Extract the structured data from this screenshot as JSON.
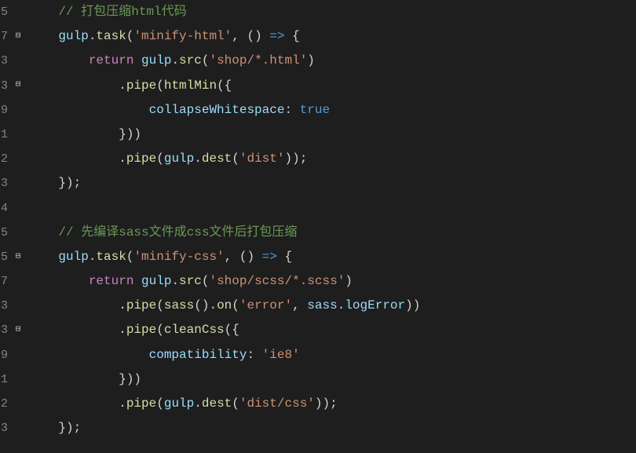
{
  "lineNumbers": [
    "5",
    "7",
    "3",
    "3",
    "9",
    "1",
    "2",
    "3",
    "4",
    "5",
    "5",
    "7",
    "3",
    "3",
    "9",
    "1",
    "2",
    "3"
  ],
  "folds": [
    "",
    "⊟",
    "",
    "⊟",
    "",
    "",
    "",
    "",
    "",
    "",
    "⊟",
    "",
    "",
    "⊟",
    "",
    "",
    "",
    ""
  ],
  "code": {
    "l1_comment": "// 打包压缩html代码",
    "l2_gulp": "gulp",
    "l2_task": "task",
    "l2_str": "'minify-html'",
    "l3_return": "return",
    "l3_gulp": "gulp",
    "l3_src": "src",
    "l3_str": "'shop/*.html'",
    "l4_pipe": "pipe",
    "l4_htmlMin": "htmlMin",
    "l5_collapse": "collapseWhitespace",
    "l5_true": "true",
    "l6_close": "}))",
    "l7_pipe": "pipe",
    "l7_gulp": "gulp",
    "l7_dest": "dest",
    "l7_str": "'dist'",
    "l8_close": "});",
    "l10_comment": "// 先编译sass文件成css文件后打包压缩",
    "l11_gulp": "gulp",
    "l11_task": "task",
    "l11_str": "'minify-css'",
    "l12_return": "return",
    "l12_gulp": "gulp",
    "l12_src": "src",
    "l12_str": "'shop/scss/*.scss'",
    "l13_pipe": "pipe",
    "l13_sass": "sass",
    "l13_on": "on",
    "l13_err": "'error'",
    "l13_sass2": "sass",
    "l13_logErr": "logError",
    "l14_pipe": "pipe",
    "l14_cleanCss": "cleanCss",
    "l15_compat": "compatibility",
    "l15_ie8": "'ie8'",
    "l16_close": "}))",
    "l17_pipe": "pipe",
    "l17_gulp": "gulp",
    "l17_dest": "dest",
    "l17_str": "'dist/css'",
    "l18_close": "});"
  }
}
